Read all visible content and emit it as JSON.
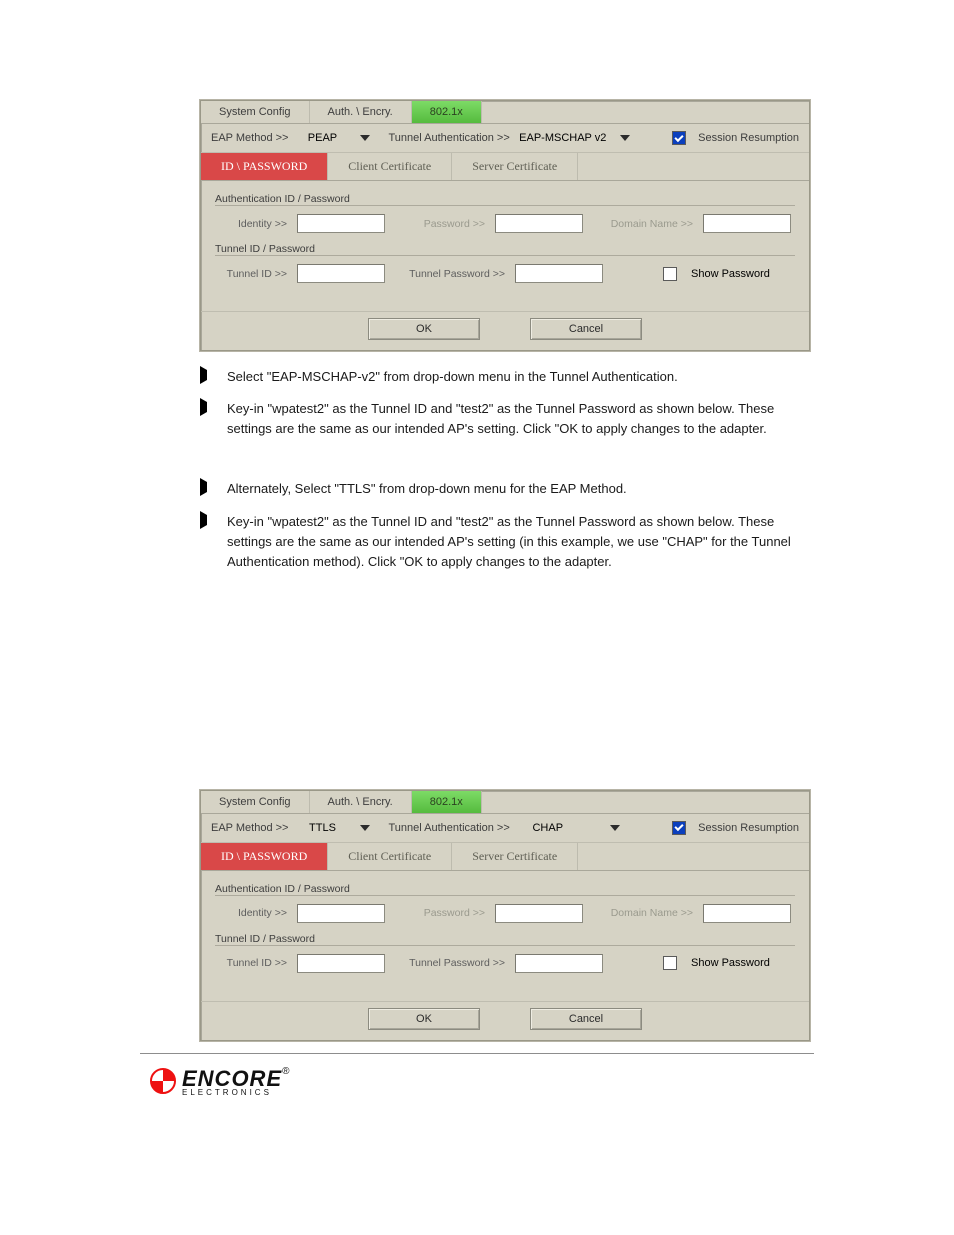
{
  "dialog1": {
    "outer_tabs": [
      "System Config",
      "Auth. \\ Encry.",
      "802.1x"
    ],
    "active_outer_tab": "802.1x",
    "eap_method_label": "EAP Method >>",
    "eap_method_value": "PEAP",
    "tunnel_auth_label": "Tunnel Authentication >>",
    "tunnel_auth_value": "EAP-MSCHAP v2",
    "session_resumption_label": "Session Resumption",
    "session_resumption_checked": true,
    "inner_tabs": [
      "ID \\ PASSWORD",
      "Client Certificate",
      "Server Certificate"
    ],
    "active_inner_tab": "ID \\ PASSWORD",
    "fs1_label": "Authentication ID / Password",
    "identity_label": "Identity >>",
    "password_label": "Password >>",
    "domain_label": "Domain Name >>",
    "fs2_label": "Tunnel ID / Password",
    "tunnel_id_label": "Tunnel ID >>",
    "tunnel_pwd_label": "Tunnel Password >>",
    "show_pwd_label": "Show Password",
    "show_pwd_checked": false,
    "ok": "OK",
    "cancel": "Cancel"
  },
  "bullets1": [
    "Select \"EAP-MSCHAP-v2\" from drop-down menu in the Tunnel Authentication.",
    "Key-in \"wpatest2\" as the Tunnel ID and \"test2\" as the Tunnel Password as shown below. These settings are the same as our intended AP's setting. Click \"OK to apply changes to the adapter."
  ],
  "bullets2": [
    "Alternately, Select \"TTLS\" from drop-down menu for the EAP Method.",
    "Key-in \"wpatest2\" as the Tunnel ID and \"test2\" as the Tunnel Password as shown below. These settings are the same as our intended AP's setting (in this example, we use \"CHAP\" for the Tunnel Authentication method). Click \"OK to apply changes to the adapter."
  ],
  "dialog2": {
    "outer_tabs": [
      "System Config",
      "Auth. \\ Encry.",
      "802.1x"
    ],
    "active_outer_tab": "802.1x",
    "eap_method_label": "EAP Method >>",
    "eap_method_value": "TTLS",
    "tunnel_auth_label": "Tunnel Authentication >>",
    "tunnel_auth_value": "CHAP",
    "session_resumption_label": "Session Resumption",
    "session_resumption_checked": true,
    "inner_tabs": [
      "ID \\ PASSWORD",
      "Client Certificate",
      "Server Certificate"
    ],
    "active_inner_tab": "ID \\ PASSWORD",
    "fs1_label": "Authentication ID / Password",
    "identity_label": "Identity >>",
    "password_label": "Password >>",
    "domain_label": "Domain Name >>",
    "fs2_label": "Tunnel ID / Password",
    "tunnel_id_label": "Tunnel ID >>",
    "tunnel_pwd_label": "Tunnel Password >>",
    "show_pwd_label": "Show Password",
    "show_pwd_checked": false,
    "ok": "OK",
    "cancel": "Cancel"
  },
  "footer": {
    "brand": "ENCORE",
    "sub": "ELECTRONICS",
    "reg": "®"
  }
}
